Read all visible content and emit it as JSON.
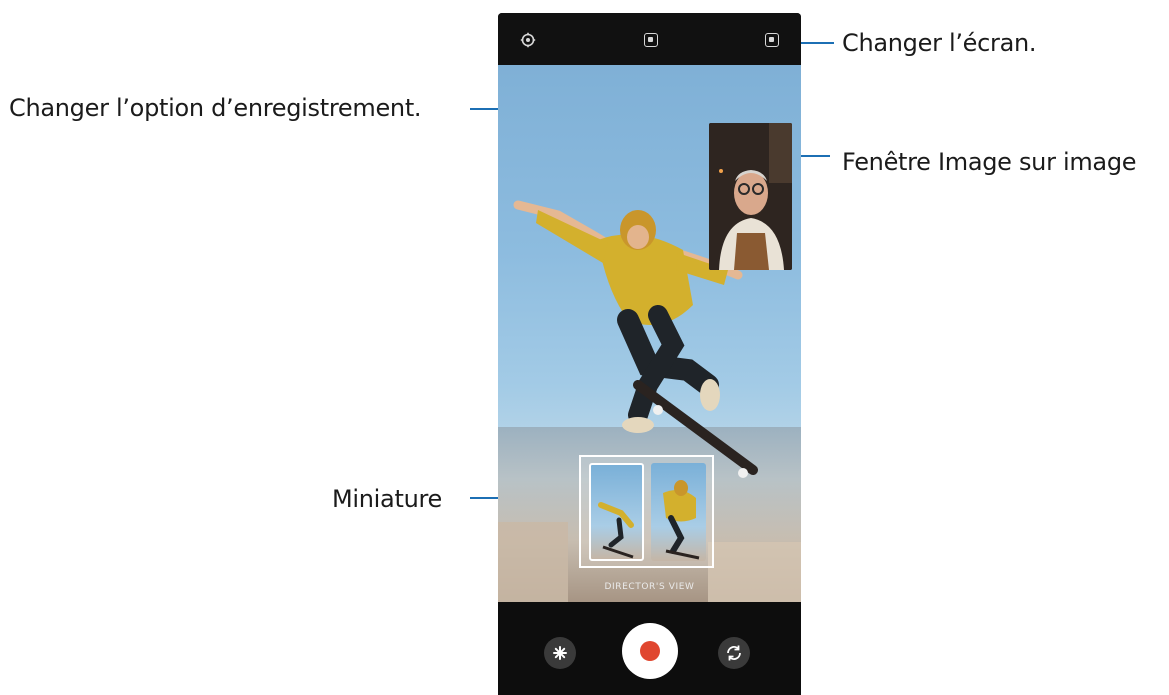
{
  "callouts": {
    "change_screen": "Changer l’écran.",
    "change_recording_option": "Changer l’option d’enregistrement.",
    "pip_window": "Fenêtre Image sur image",
    "thumbnail": "Miniature"
  },
  "camera": {
    "mode_label": "DIRECTOR'S VIEW",
    "accent_color": "#1c6fb4",
    "record_color": "#e0462f",
    "icons": [
      "settings-icon",
      "recording-option-icon",
      "change-screen-icon",
      "effects-icon",
      "record-icon",
      "switch-camera-icon"
    ]
  }
}
